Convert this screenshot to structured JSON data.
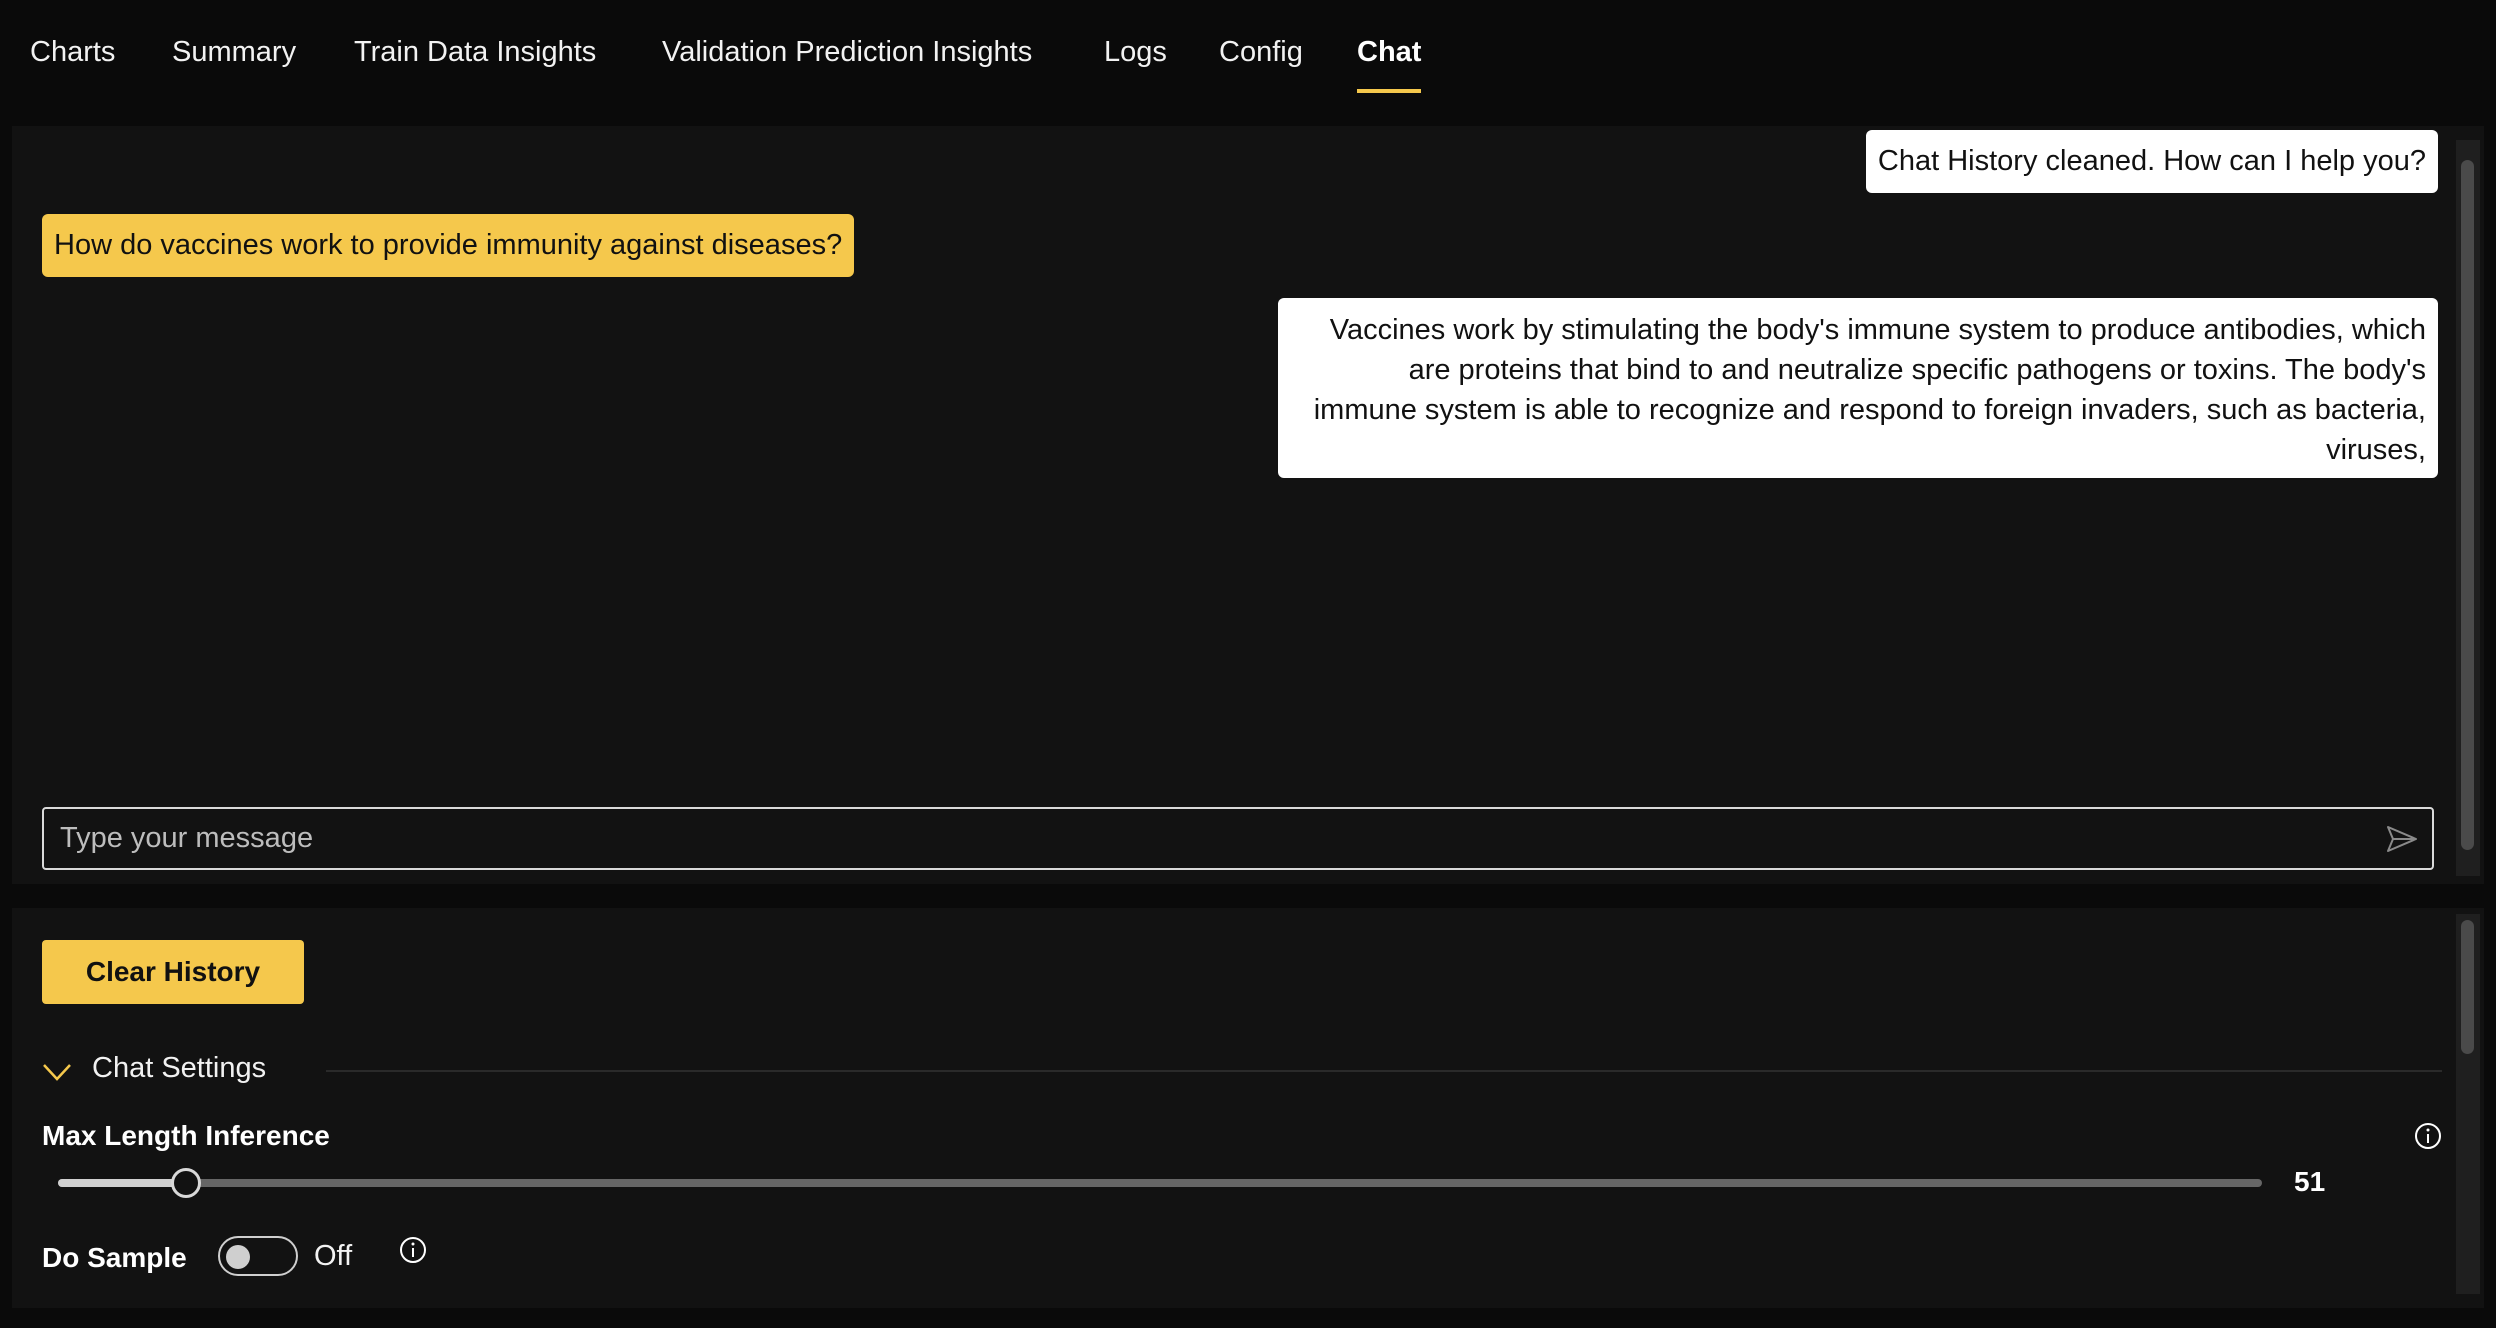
{
  "tabs": [
    {
      "label": "Charts",
      "active": false
    },
    {
      "label": "Summary",
      "active": false
    },
    {
      "label": "Train Data Insights",
      "active": false
    },
    {
      "label": "Validation Prediction Insights",
      "active": false
    },
    {
      "label": "Logs",
      "active": false
    },
    {
      "label": "Config",
      "active": false
    },
    {
      "label": "Chat",
      "active": true
    }
  ],
  "chat": {
    "messages": [
      {
        "role": "bot",
        "text": "Chat History cleaned. How can I help you?"
      },
      {
        "role": "user",
        "text": "How do vaccines work to provide immunity against diseases?"
      },
      {
        "role": "bot",
        "lines": [
          "Vaccines work by stimulating the body's immune system to produce antibodies, which",
          "are proteins that bind to and neutralize specific pathogens or toxins. The body's",
          "immune system is able to recognize and respond to foreign invaders, such as bacteria,",
          "viruses,"
        ]
      }
    ],
    "input": {
      "value": "",
      "placeholder": "Type your message"
    },
    "send_icon": "send-icon"
  },
  "settings": {
    "clear_button": "Clear History",
    "section_title": "Chat Settings",
    "max_length": {
      "label": "Max Length Inference",
      "value": "51",
      "fraction": 0.049
    },
    "do_sample": {
      "label": "Do Sample",
      "state": "Off"
    },
    "colors": {
      "accent": "#f5c84c",
      "panel": "#121212",
      "background": "#0a0a0a"
    }
  }
}
